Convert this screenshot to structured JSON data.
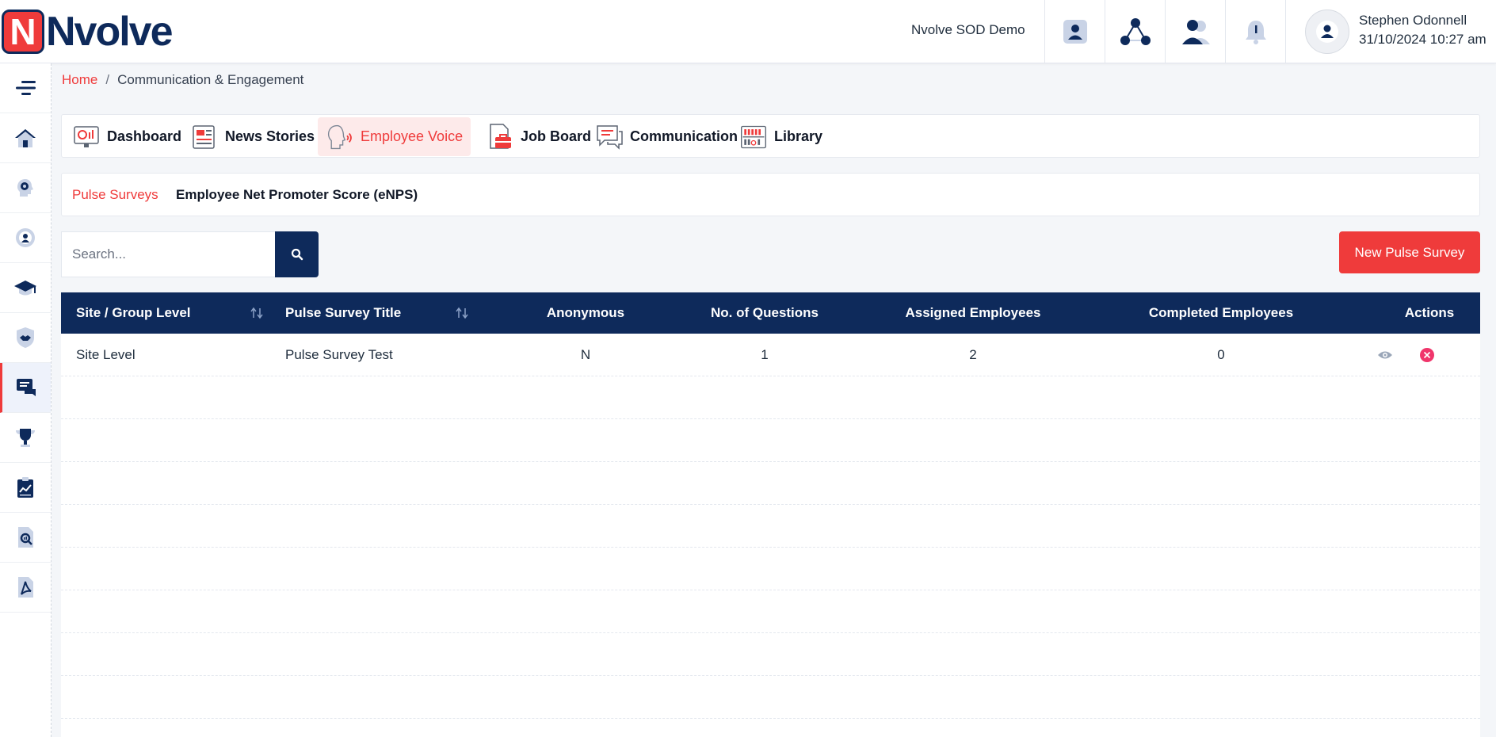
{
  "app": {
    "brand_mark": "N",
    "brand_text": "Nvolve",
    "company": "Nvolve SOD Demo",
    "user_name": "Stephen Odonnell",
    "user_datetime": "31/10/2024 10:27 am"
  },
  "header_icons": [
    "profile-card-icon",
    "network-icon",
    "users-icon",
    "bell-icon"
  ],
  "sidebar": {
    "items": [
      {
        "name": "menu-toggle-icon"
      },
      {
        "name": "home-icon"
      },
      {
        "name": "head-gear-icon"
      },
      {
        "name": "settings-user-icon"
      },
      {
        "name": "graduation-cap-icon"
      },
      {
        "name": "shield-handshake-icon"
      },
      {
        "name": "chat-icon",
        "active": true
      },
      {
        "name": "trophy-icon"
      },
      {
        "name": "chart-clipboard-icon"
      },
      {
        "name": "document-search-icon"
      },
      {
        "name": "pdf-icon"
      }
    ]
  },
  "breadcrumb": {
    "home": "Home",
    "separator": "/",
    "current": "Communication & Engagement"
  },
  "module_tabs": [
    {
      "label": "Dashboard",
      "icon": "dashboard-icon"
    },
    {
      "label": "News Stories",
      "icon": "newspaper-icon"
    },
    {
      "label": "Employee Voice",
      "icon": "speaking-head-icon",
      "active": true
    },
    {
      "label": "Job Board",
      "icon": "briefcase-document-icon"
    },
    {
      "label": "Communication",
      "icon": "chat-bubbles-icon"
    },
    {
      "label": "Library",
      "icon": "library-icon"
    }
  ],
  "sub_tabs": [
    {
      "label": "Pulse Surveys",
      "active": true
    },
    {
      "label": "Employee Net Promoter Score (eNPS)",
      "active": false
    }
  ],
  "search": {
    "placeholder": "Search...",
    "value": ""
  },
  "new_button_label": "New Pulse Survey",
  "table": {
    "columns": [
      "Site / Group Level",
      "Pulse Survey Title",
      "Anonymous",
      "No. of Questions",
      "Assigned Employees",
      "Completed Employees",
      "Actions"
    ],
    "rows": [
      {
        "site_level": "Site Level",
        "title": "Pulse Survey Test",
        "anonymous": "N",
        "questions": "1",
        "assigned": "2",
        "completed": "0"
      }
    ]
  },
  "colors": {
    "primary_navy": "#0e2a5b",
    "accent_red": "#ef3b3b",
    "delete_pink": "#f0356b"
  }
}
